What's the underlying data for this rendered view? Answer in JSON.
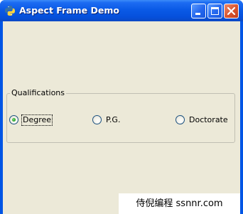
{
  "window": {
    "title": "Aspect Frame Demo",
    "controls": {
      "minimize": "minimize-icon",
      "maximize": "maximize-icon",
      "close": "close-icon"
    },
    "app_icon": "python-icon"
  },
  "qualifications": {
    "label": "Qualifications",
    "options": [
      {
        "label": "Degree",
        "selected": true,
        "focused": true
      },
      {
        "label": "P.G.",
        "selected": false,
        "focused": false
      },
      {
        "label": "Doctorate",
        "selected": false,
        "focused": false
      }
    ]
  },
  "watermark": {
    "text": "侍倪编程 ssnnr.com"
  },
  "colors": {
    "titlebar": "#0a5ae6",
    "client": "#ece9d8",
    "close_button": "#d8542e",
    "radio_dot": "#2aa02a"
  }
}
